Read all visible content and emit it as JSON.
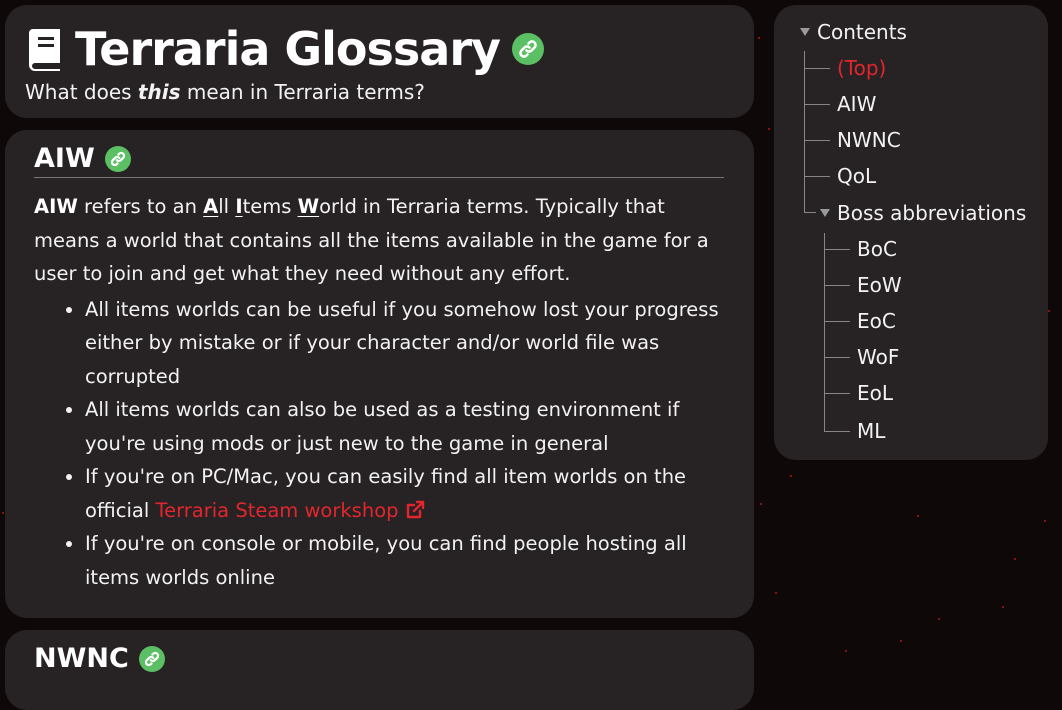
{
  "header": {
    "title": "Terraria Glossary",
    "subtitle_pre": "What does ",
    "subtitle_em": "this",
    "subtitle_post": " mean in Terraria terms?"
  },
  "aiw": {
    "title": "AIW",
    "intro_term": "AIW",
    "intro_mid": " refers to an ",
    "acr_a": "A",
    "acr_a_rest": "ll ",
    "acr_i": "I",
    "acr_i_rest": "tems ",
    "acr_w": "W",
    "acr_w_rest": "orld",
    "intro_rest": " in Terraria terms. Typically that means a world that contains all the items available in the game for a user to join and get what they need without any effort.",
    "bullets": [
      "All items worlds can be useful if you somehow lost your progress either by mistake or if your character and/or world file was corrupted",
      "All items worlds can also be used as a testing environment if you're using mods or just new to the game in general",
      "If you're on PC/Mac, you can easily find all item worlds on the official ",
      "If you're on console or mobile, you can find people hosting all items worlds online"
    ],
    "link_text": "Terraria Steam workshop"
  },
  "nwnc": {
    "title": "NWNC"
  },
  "toc": {
    "heading": "Contents",
    "items": [
      "(Top)",
      "AIW",
      "NWNC",
      "QoL",
      "Boss abbreviations"
    ],
    "sub_items": [
      "BoC",
      "EoW",
      "EoC",
      "WoF",
      "EoL",
      "ML"
    ]
  },
  "colors": {
    "background": "#0f0809",
    "card": "#272223",
    "accent_red": "#e3262d",
    "link_badge_green": "#5bbf64"
  },
  "icons": [
    "book-icon",
    "link-icon",
    "external-link-icon",
    "caret-down-icon"
  ]
}
